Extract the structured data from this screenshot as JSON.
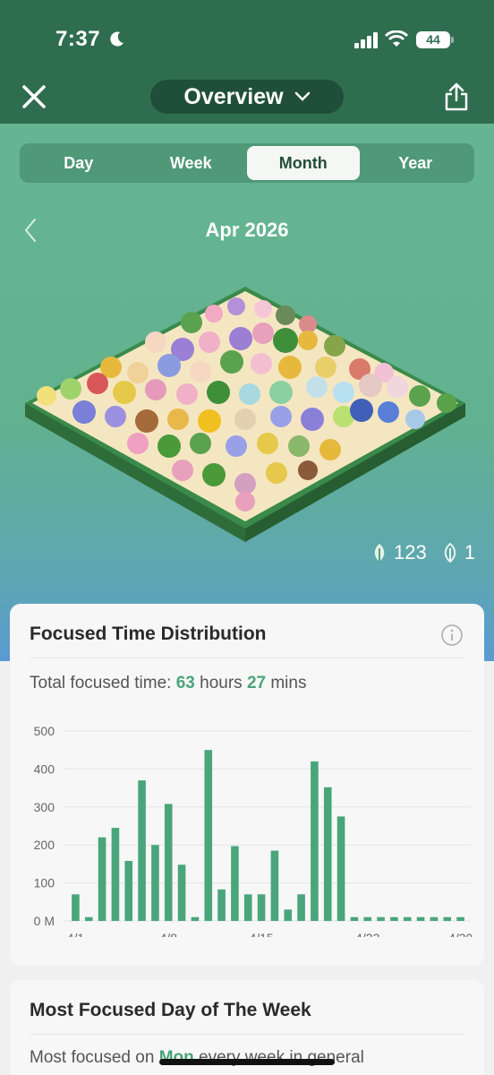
{
  "status_bar": {
    "time": "7:37",
    "battery": "44"
  },
  "header": {
    "title": "Overview"
  },
  "tabs": [
    {
      "label": "Day",
      "active": false
    },
    {
      "label": "Week",
      "active": false
    },
    {
      "label": "Month",
      "active": true
    },
    {
      "label": "Year",
      "active": false
    }
  ],
  "period": {
    "label": "Apr 2026"
  },
  "forest_counts": {
    "healthy_trees": "123",
    "withered_trees": "1"
  },
  "focused_card": {
    "title": "Focused Time Distribution",
    "total_prefix": "Total focused time:",
    "hours": "63",
    "hours_label": "hours",
    "mins": "27",
    "mins_label": "mins"
  },
  "chart_data": {
    "type": "bar",
    "x": [
      "4/1",
      "4/2",
      "4/3",
      "4/4",
      "4/5",
      "4/6",
      "4/7",
      "4/8",
      "4/9",
      "4/10",
      "4/11",
      "4/12",
      "4/13",
      "4/14",
      "4/15",
      "4/16",
      "4/17",
      "4/18",
      "4/19",
      "4/20",
      "4/21",
      "4/22",
      "4/23",
      "4/24",
      "4/25",
      "4/26",
      "4/27",
      "4/28",
      "4/29",
      "4/30"
    ],
    "values": [
      70,
      10,
      220,
      245,
      158,
      370,
      200,
      308,
      148,
      10,
      450,
      83,
      197,
      70,
      70,
      185,
      30,
      70,
      420,
      352,
      275,
      10,
      10,
      10,
      10,
      10,
      10,
      10,
      10,
      10
    ],
    "tick_labels_x": [
      "4/1",
      "4/8",
      "4/15",
      "4/23",
      "4/30"
    ],
    "tick_labels_y": [
      "0 M",
      "100",
      "200",
      "300",
      "400",
      "500"
    ],
    "ylim": [
      0,
      500
    ],
    "bar_color": "#4aa57b",
    "grid": true
  },
  "weekday_card": {
    "title": "Most Focused Day of The Week",
    "text_prefix": "Most focused on",
    "day": "Mon",
    "text_suffix": "every week in general"
  },
  "colors": {
    "header_bg": "#2f6d4f",
    "accent": "#4aa57b"
  }
}
